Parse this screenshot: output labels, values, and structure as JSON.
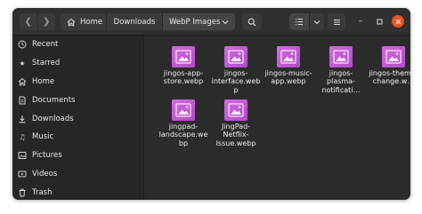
{
  "breadcrumb": {
    "home_label": "Home",
    "downloads_label": "Downloads",
    "current_label": "WebP Images"
  },
  "sidebar": {
    "items": [
      {
        "label": "Recent",
        "icon": "clock-icon"
      },
      {
        "label": "Starred",
        "icon": "star-icon"
      },
      {
        "label": "Home",
        "icon": "home-icon"
      },
      {
        "label": "Documents",
        "icon": "document-icon"
      },
      {
        "label": "Downloads",
        "icon": "download-icon"
      },
      {
        "label": "Music",
        "icon": "music-icon"
      },
      {
        "label": "Pictures",
        "icon": "pictures-icon"
      },
      {
        "label": "Videos",
        "icon": "video-icon"
      },
      {
        "label": "Trash",
        "icon": "trash-icon"
      }
    ]
  },
  "files": [
    {
      "name": "jingos-app-store.webp"
    },
    {
      "name": "jingos-interface.webp"
    },
    {
      "name": "jingos-music-app.webp"
    },
    {
      "name": "jingos-plasma-notificati…"
    },
    {
      "name": "jingos-theme-change.w…"
    },
    {
      "name": "jingpad-landscape.webp"
    },
    {
      "name": "JingPad-Netflix-Issue.webp"
    }
  ],
  "colors": {
    "window_bg": "#2b2b2b",
    "sidebar_bg": "#262626",
    "accent_close": "#e95420",
    "thumbnail": "#c55bd6"
  }
}
